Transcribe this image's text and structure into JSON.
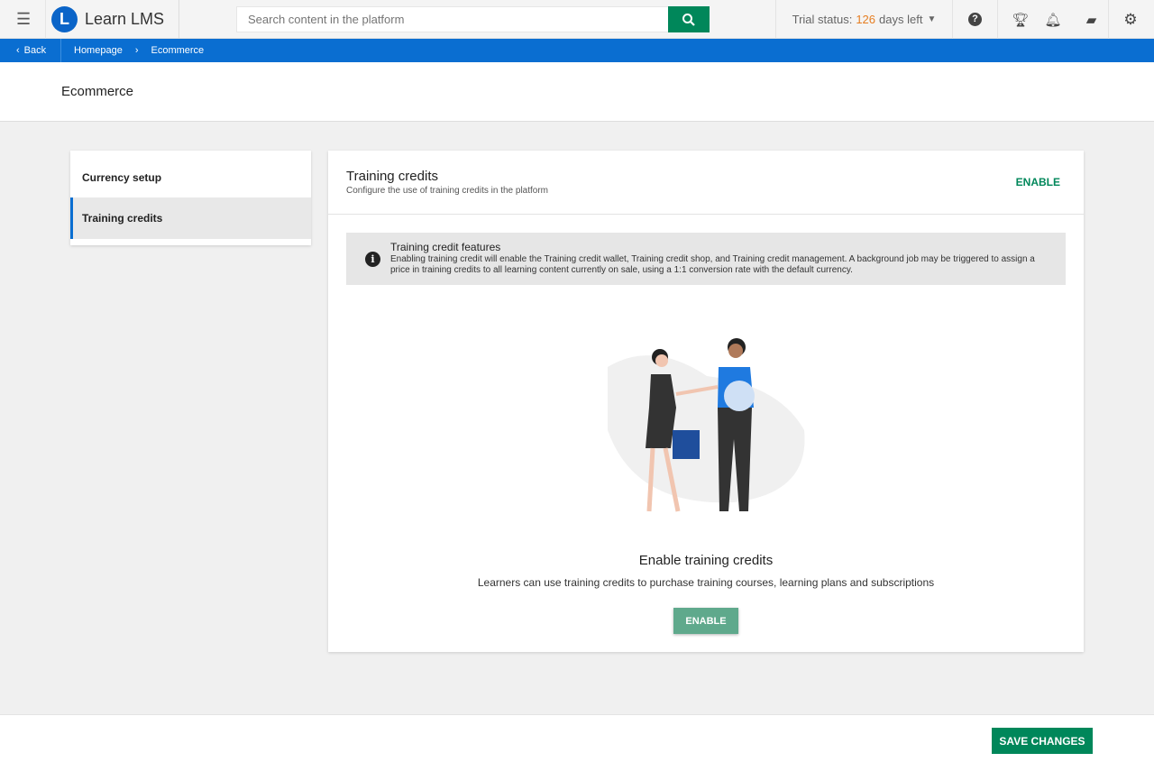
{
  "app": {
    "name": "Learn LMS",
    "logo_letter": "L"
  },
  "search": {
    "placeholder": "Search content in the platform"
  },
  "trial": {
    "prefix": "Trial status:",
    "days": "126",
    "suffix": "days left"
  },
  "breadcrumb": {
    "back": "Back",
    "items": [
      "Homepage",
      "Ecommerce"
    ]
  },
  "page": {
    "title": "Ecommerce"
  },
  "sidebar": {
    "items": [
      {
        "label": "Currency setup"
      },
      {
        "label": "Training credits"
      }
    ]
  },
  "panel": {
    "title": "Training credits",
    "subtitle": "Configure the use of training credits in the platform",
    "enable_link": "ENABLE",
    "info_title": "Training credit features",
    "info_text": "Enabling training credit will enable the Training credit wallet, Training credit shop, and Training credit management. A background job may be triggered to assign a price in training credits to all learning content currently on sale, using a 1:1 conversion rate with the default currency.",
    "empty_title": "Enable training credits",
    "empty_text": "Learners can use training credits to purchase training courses, learning plans and subscriptions",
    "enable_button": "ENABLE"
  },
  "footer": {
    "save": "SAVE CHANGES"
  }
}
